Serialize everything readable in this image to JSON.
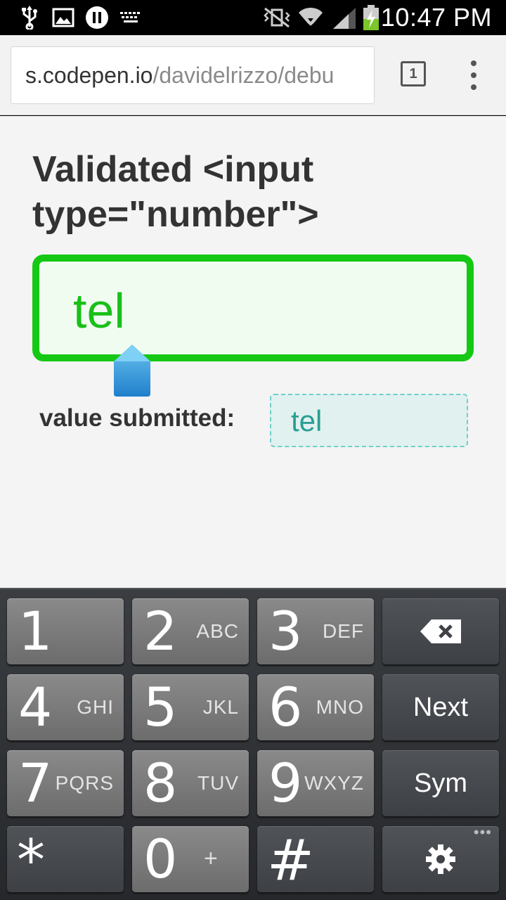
{
  "status_bar": {
    "time": "10:47 PM",
    "icons": [
      "usb-icon",
      "image-icon",
      "media-pause-icon",
      "keyboard-icon",
      "mute-vibrate-icon",
      "wifi-icon",
      "cell-signal-icon",
      "battery-charging-icon"
    ]
  },
  "browser": {
    "url_host": "s.codepen.io",
    "url_path": "/davidelrizzo/debu",
    "tab_count": "1"
  },
  "page": {
    "heading": "Validated <input type=\"number\">",
    "input_value": "tel",
    "submitted_label": "value submitted:",
    "submitted_value": "tel"
  },
  "keyboard": {
    "rows": [
      [
        {
          "digit": "1",
          "letters": ""
        },
        {
          "digit": "2",
          "letters": "ABC"
        },
        {
          "digit": "3",
          "letters": "DEF"
        },
        {
          "special": "backspace"
        }
      ],
      [
        {
          "digit": "4",
          "letters": "GHI"
        },
        {
          "digit": "5",
          "letters": "JKL"
        },
        {
          "digit": "6",
          "letters": "MNO"
        },
        {
          "word": "Next"
        }
      ],
      [
        {
          "digit": "7",
          "letters": "PQRS"
        },
        {
          "digit": "8",
          "letters": "TUV"
        },
        {
          "digit": "9",
          "letters": "WXYZ"
        },
        {
          "word": "Sym"
        }
      ],
      [
        {
          "sym": "*"
        },
        {
          "digit": "0",
          "plus": "+"
        },
        {
          "sym": "#"
        },
        {
          "special": "settings"
        }
      ]
    ]
  },
  "colors": {
    "input_border": "#14c814",
    "input_text": "#19c019",
    "submitted_text": "#2a9e92",
    "cursor_handle": "#2a8fd8"
  }
}
